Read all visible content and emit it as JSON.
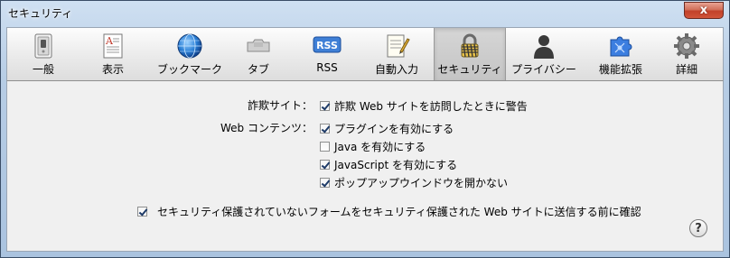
{
  "window": {
    "title": "セキュリティ",
    "close_glyph": "x"
  },
  "toolbar": {
    "tabs": [
      {
        "label": "一般",
        "icon": "switch-icon"
      },
      {
        "label": "表示",
        "icon": "font-document-icon"
      },
      {
        "label": "ブックマーク",
        "icon": "globe-icon"
      },
      {
        "label": "タブ",
        "icon": "tab-icon"
      },
      {
        "label": "RSS",
        "icon": "rss-icon",
        "badge": "RSS"
      },
      {
        "label": "自動入力",
        "icon": "pencil-form-icon"
      },
      {
        "label": "セキュリティ",
        "icon": "padlock-icon",
        "selected": true
      },
      {
        "label": "プライバシー",
        "icon": "person-silhouette-icon"
      },
      {
        "label": "機能拡張",
        "icon": "puzzle-extension-icon"
      },
      {
        "label": "詳細",
        "icon": "gear-icon"
      }
    ]
  },
  "security": {
    "fraud_label": "詐欺サイト：",
    "fraud_option": {
      "label": "詐欺 Web サイトを訪問したときに警告",
      "checked": true
    },
    "web_content_label": "Web コンテンツ：",
    "web_content_options": [
      {
        "label": "プラグインを有効にする",
        "checked": true
      },
      {
        "label": "Java を有効にする",
        "checked": false
      },
      {
        "label": "JavaScript を有効にする",
        "checked": true
      },
      {
        "label": "ポップアップウインドウを開かない",
        "checked": true
      }
    ],
    "insecure_form_option": {
      "label": "セキュリティ保護されていないフォームをセキュリティ保護された Web サイトに送信する前に確認",
      "checked": true
    }
  },
  "help": {
    "label": "?"
  }
}
